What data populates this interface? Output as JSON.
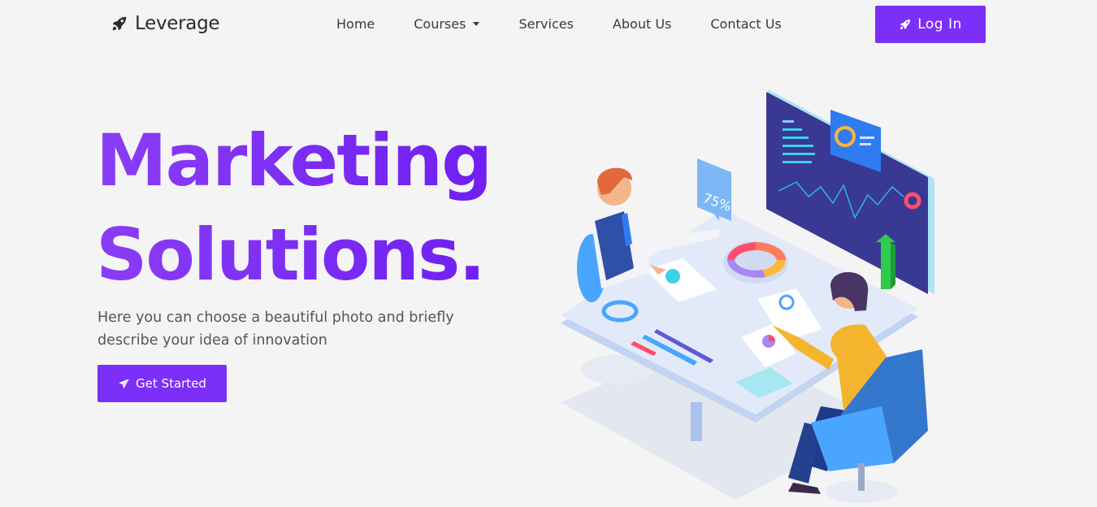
{
  "brand": {
    "name": "Leverage",
    "icon": "rocket-icon"
  },
  "nav": {
    "items": [
      {
        "label": "Home"
      },
      {
        "label": "Courses",
        "dropdown": true
      },
      {
        "label": "Services"
      },
      {
        "label": "About Us"
      },
      {
        "label": "Contact Us"
      }
    ],
    "login_label": "Log In"
  },
  "hero": {
    "title_line1": "Marketing",
    "title_line2": "Solutions.",
    "description": "Here you can choose a beautiful photo and briefly describe your idea of innovation",
    "cta_label": "Get Started"
  },
  "illustration": {
    "percent_card": "75%"
  },
  "colors": {
    "accent": "#7b2ff7",
    "background": "#f4f4f4",
    "text": "#555555"
  }
}
